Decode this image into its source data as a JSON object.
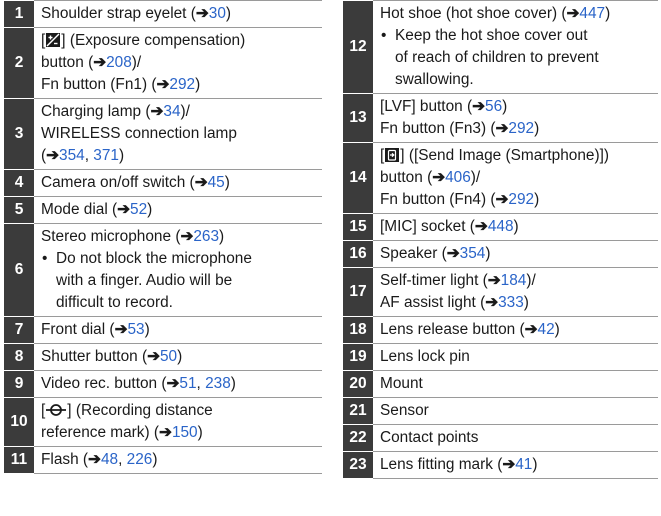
{
  "arrow": "➔",
  "left_items": [
    {
      "num": "1",
      "lines": [
        [
          "Shoulder strap eyelet (",
          {
            "ref": "30"
          },
          ")"
        ]
      ]
    },
    {
      "num": "2",
      "lines": [
        [
          "[",
          {
            "icon": "exposure-compensation"
          },
          "] (Exposure compensation)"
        ],
        [
          "button (",
          {
            "ref": "208"
          },
          ")/"
        ],
        [
          "Fn button (Fn1) (",
          {
            "ref": "292"
          },
          ")"
        ]
      ]
    },
    {
      "num": "3",
      "lines": [
        [
          "Charging lamp (",
          {
            "ref": "34"
          },
          ")/"
        ],
        [
          "WIRELESS connection lamp"
        ],
        [
          "(",
          {
            "ref": "354"
          },
          ", ",
          {
            "page": "371"
          },
          ")"
        ]
      ]
    },
    {
      "num": "4",
      "lines": [
        [
          "Camera on/off switch (",
          {
            "ref": "45"
          },
          ")"
        ]
      ]
    },
    {
      "num": "5",
      "lines": [
        [
          "Mode dial (",
          {
            "ref": "52"
          },
          ")"
        ]
      ]
    },
    {
      "num": "6",
      "lines": [
        [
          "Stereo microphone (",
          {
            "ref": "263"
          },
          ")"
        ]
      ],
      "bullet": [
        "Do not block the microphone",
        "with a finger. Audio will be",
        "difficult to record."
      ]
    },
    {
      "num": "7",
      "lines": [
        [
          "Front dial (",
          {
            "ref": "53"
          },
          ")"
        ]
      ]
    },
    {
      "num": "8",
      "lines": [
        [
          "Shutter button (",
          {
            "ref": "50"
          },
          ")"
        ]
      ]
    },
    {
      "num": "9",
      "lines": [
        [
          "Video rec. button (",
          {
            "ref": "51"
          },
          ", ",
          {
            "page": "238"
          },
          ")"
        ]
      ]
    },
    {
      "num": "10",
      "lines": [
        [
          "[",
          {
            "icon": "recording-distance"
          },
          "] (Recording distance"
        ],
        [
          "reference mark) (",
          {
            "ref": "150"
          },
          ")"
        ]
      ]
    },
    {
      "num": "11",
      "lines": [
        [
          "Flash (",
          {
            "ref": "48"
          },
          ", ",
          {
            "page": "226"
          },
          ")"
        ]
      ]
    }
  ],
  "right_items": [
    {
      "num": "12",
      "lines": [
        [
          "Hot shoe (hot shoe cover) (",
          {
            "ref": "447"
          },
          ")"
        ]
      ],
      "bullet": [
        "Keep the hot shoe cover out",
        "of reach of children to prevent",
        "swallowing."
      ]
    },
    {
      "num": "13",
      "lines": [
        [
          "[LVF] button (",
          {
            "ref": "56"
          },
          ")"
        ],
        [
          "Fn button (Fn3) (",
          {
            "ref": "292"
          },
          ")"
        ]
      ]
    },
    {
      "num": "14",
      "lines": [
        [
          "[",
          {
            "icon": "send-image"
          },
          "] ([Send Image (Smartphone)])"
        ],
        [
          "button (",
          {
            "ref": "406"
          },
          ")/"
        ],
        [
          "Fn button (Fn4) (",
          {
            "ref": "292"
          },
          ")"
        ]
      ]
    },
    {
      "num": "15",
      "lines": [
        [
          "[MIC] socket (",
          {
            "ref": "448"
          },
          ")"
        ]
      ]
    },
    {
      "num": "16",
      "lines": [
        [
          "Speaker (",
          {
            "ref": "354"
          },
          ")"
        ]
      ]
    },
    {
      "num": "17",
      "lines": [
        [
          "Self-timer light (",
          {
            "ref": "184"
          },
          ")/"
        ],
        [
          "AF assist light (",
          {
            "ref": "333"
          },
          ")"
        ]
      ]
    },
    {
      "num": "18",
      "lines": [
        [
          "Lens release button (",
          {
            "ref": "42"
          },
          ")"
        ]
      ]
    },
    {
      "num": "19",
      "lines": [
        [
          "Lens lock pin"
        ]
      ]
    },
    {
      "num": "20",
      "lines": [
        [
          "Mount"
        ]
      ]
    },
    {
      "num": "21",
      "lines": [
        [
          "Sensor"
        ]
      ]
    },
    {
      "num": "22",
      "lines": [
        [
          "Contact points"
        ]
      ]
    },
    {
      "num": "23",
      "lines": [
        [
          "Lens fitting mark (",
          {
            "ref": "41"
          },
          ")"
        ]
      ]
    }
  ],
  "colors": {
    "number_cell_bg": "#3b3b3b",
    "link": "#2a64c8",
    "rule": "#9a9a9a"
  },
  "icons": {
    "exposure-compensation": "exposure-compensation-icon",
    "recording-distance": "recording-distance-mark-icon",
    "send-image": "send-image-smartphone-icon"
  }
}
